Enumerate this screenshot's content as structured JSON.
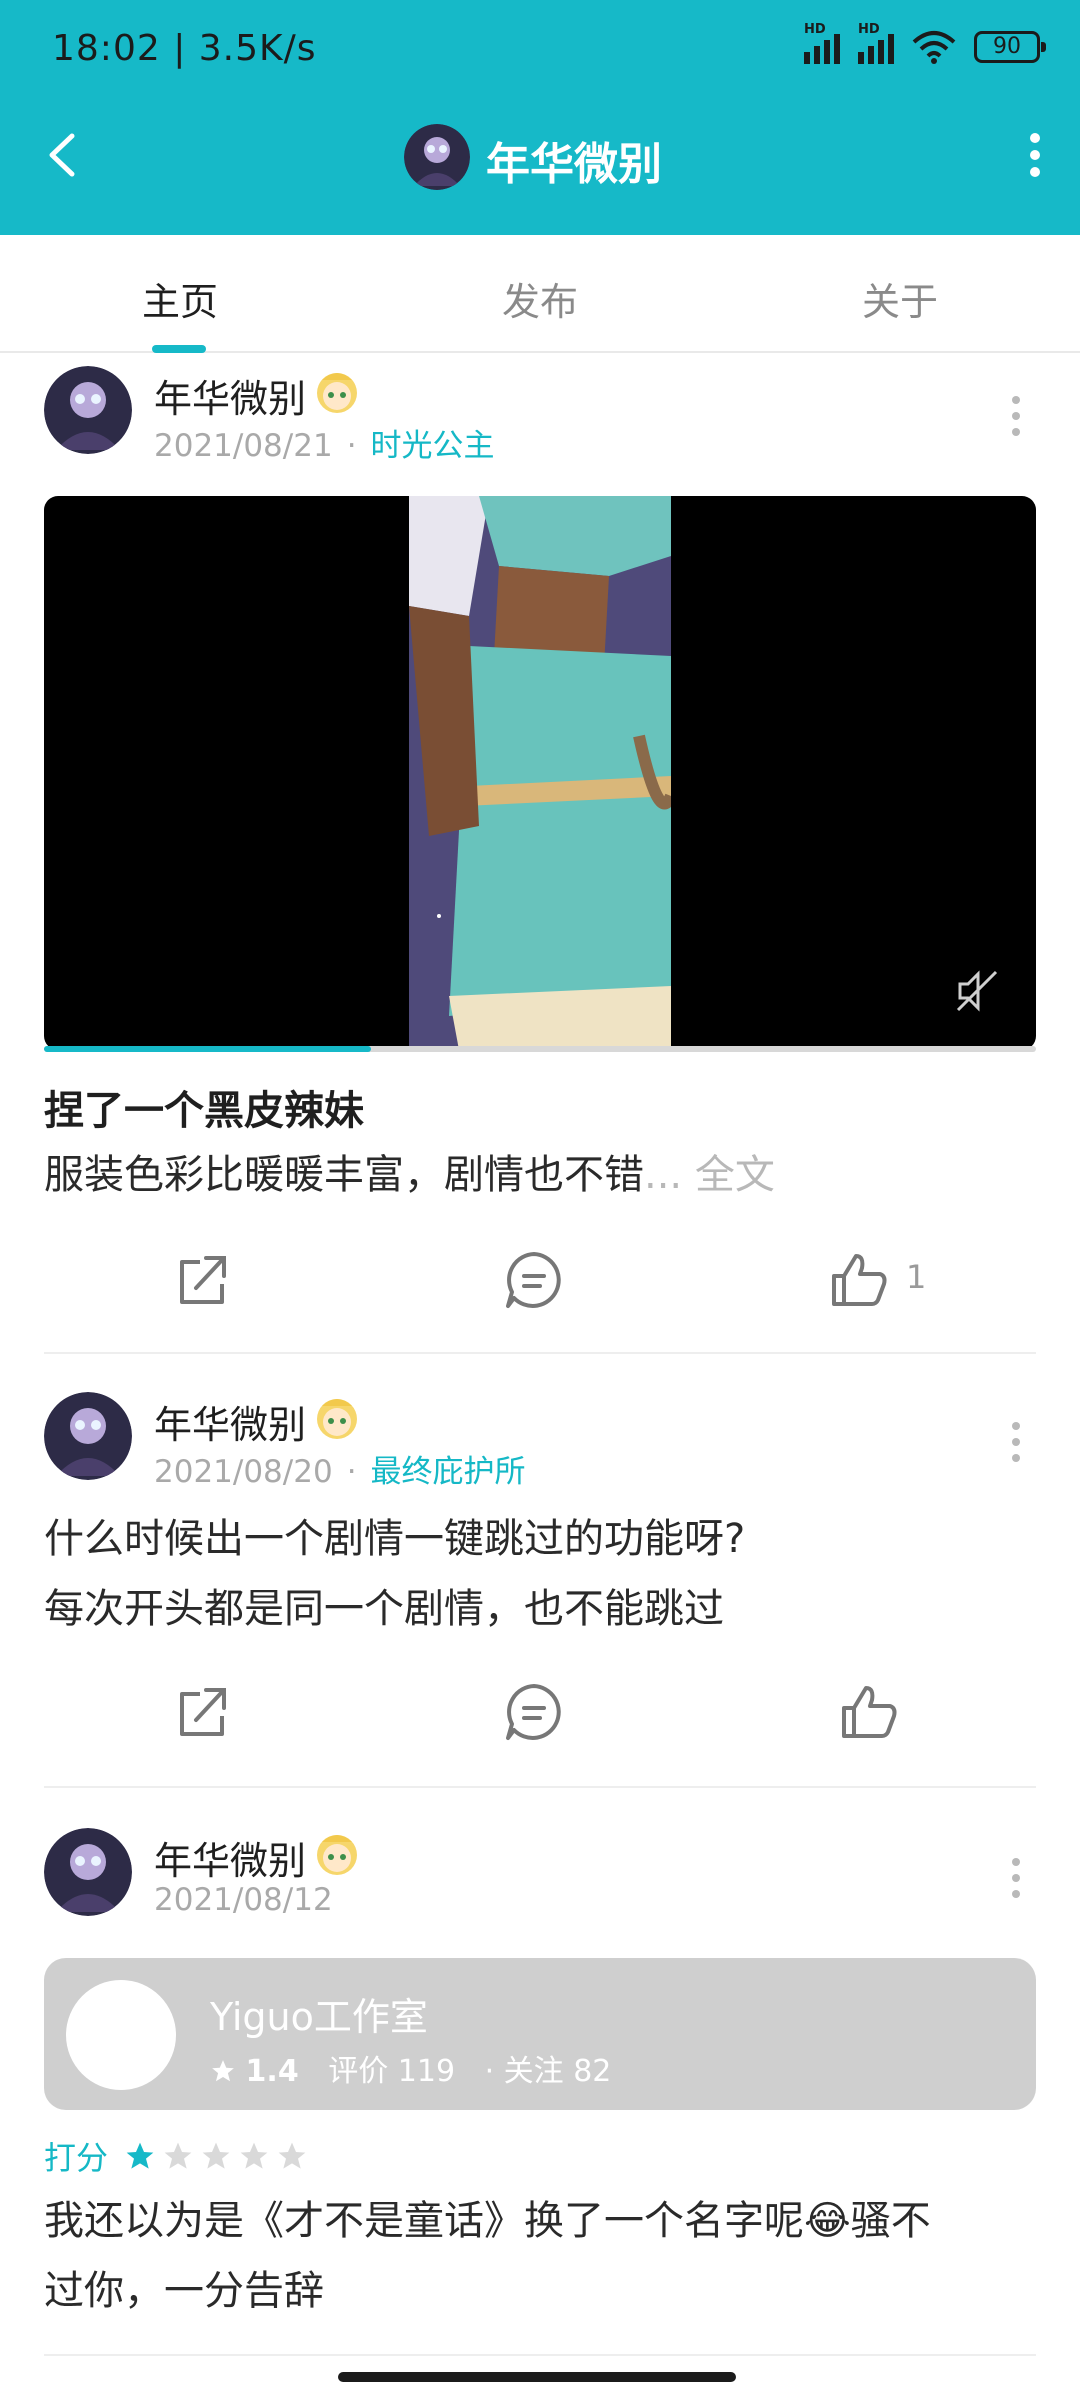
{
  "status_bar": {
    "time": "18:02 | 3.5K/s",
    "battery": "90",
    "network_badge": "HD"
  },
  "header": {
    "title": "年华微别"
  },
  "tabs": [
    {
      "label": "主页",
      "active": true
    },
    {
      "label": "发布",
      "active": false
    },
    {
      "label": "关于",
      "active": false
    }
  ],
  "posts": [
    {
      "author": "年华微别",
      "date": "2021/08/21",
      "separator": "·",
      "category": "时光公主",
      "video_progress": 0.33,
      "title": "捏了一个黑皮辣妹",
      "body": "服装色彩比暖暖丰富，剧情也不错",
      "more_link": "... 全文",
      "like_count": "1"
    },
    {
      "author": "年华微别",
      "date": "2021/08/20",
      "separator": "·",
      "category": "最终庇护所",
      "body_lines": [
        "什么时候出一个剧情一键跳过的功能呀?",
        "每次开头都是同一个剧情，也不能跳过"
      ]
    },
    {
      "author": "年华微别",
      "date": "2021/08/12",
      "app_card": {
        "name": "Yiguo工作室",
        "rating": "1.4",
        "reviews_label": "评价 119",
        "follows_label": "· 关注 82"
      },
      "score_label": "打分",
      "stars": 1,
      "stars_max": 5,
      "body_lines": [
        "我还以为是《才不是童话》换了一个名字呢😂骚不",
        "过你，一分告辞"
      ]
    }
  ],
  "colors": {
    "accent": "#16b9c8",
    "muted": "#a9a9a9"
  }
}
